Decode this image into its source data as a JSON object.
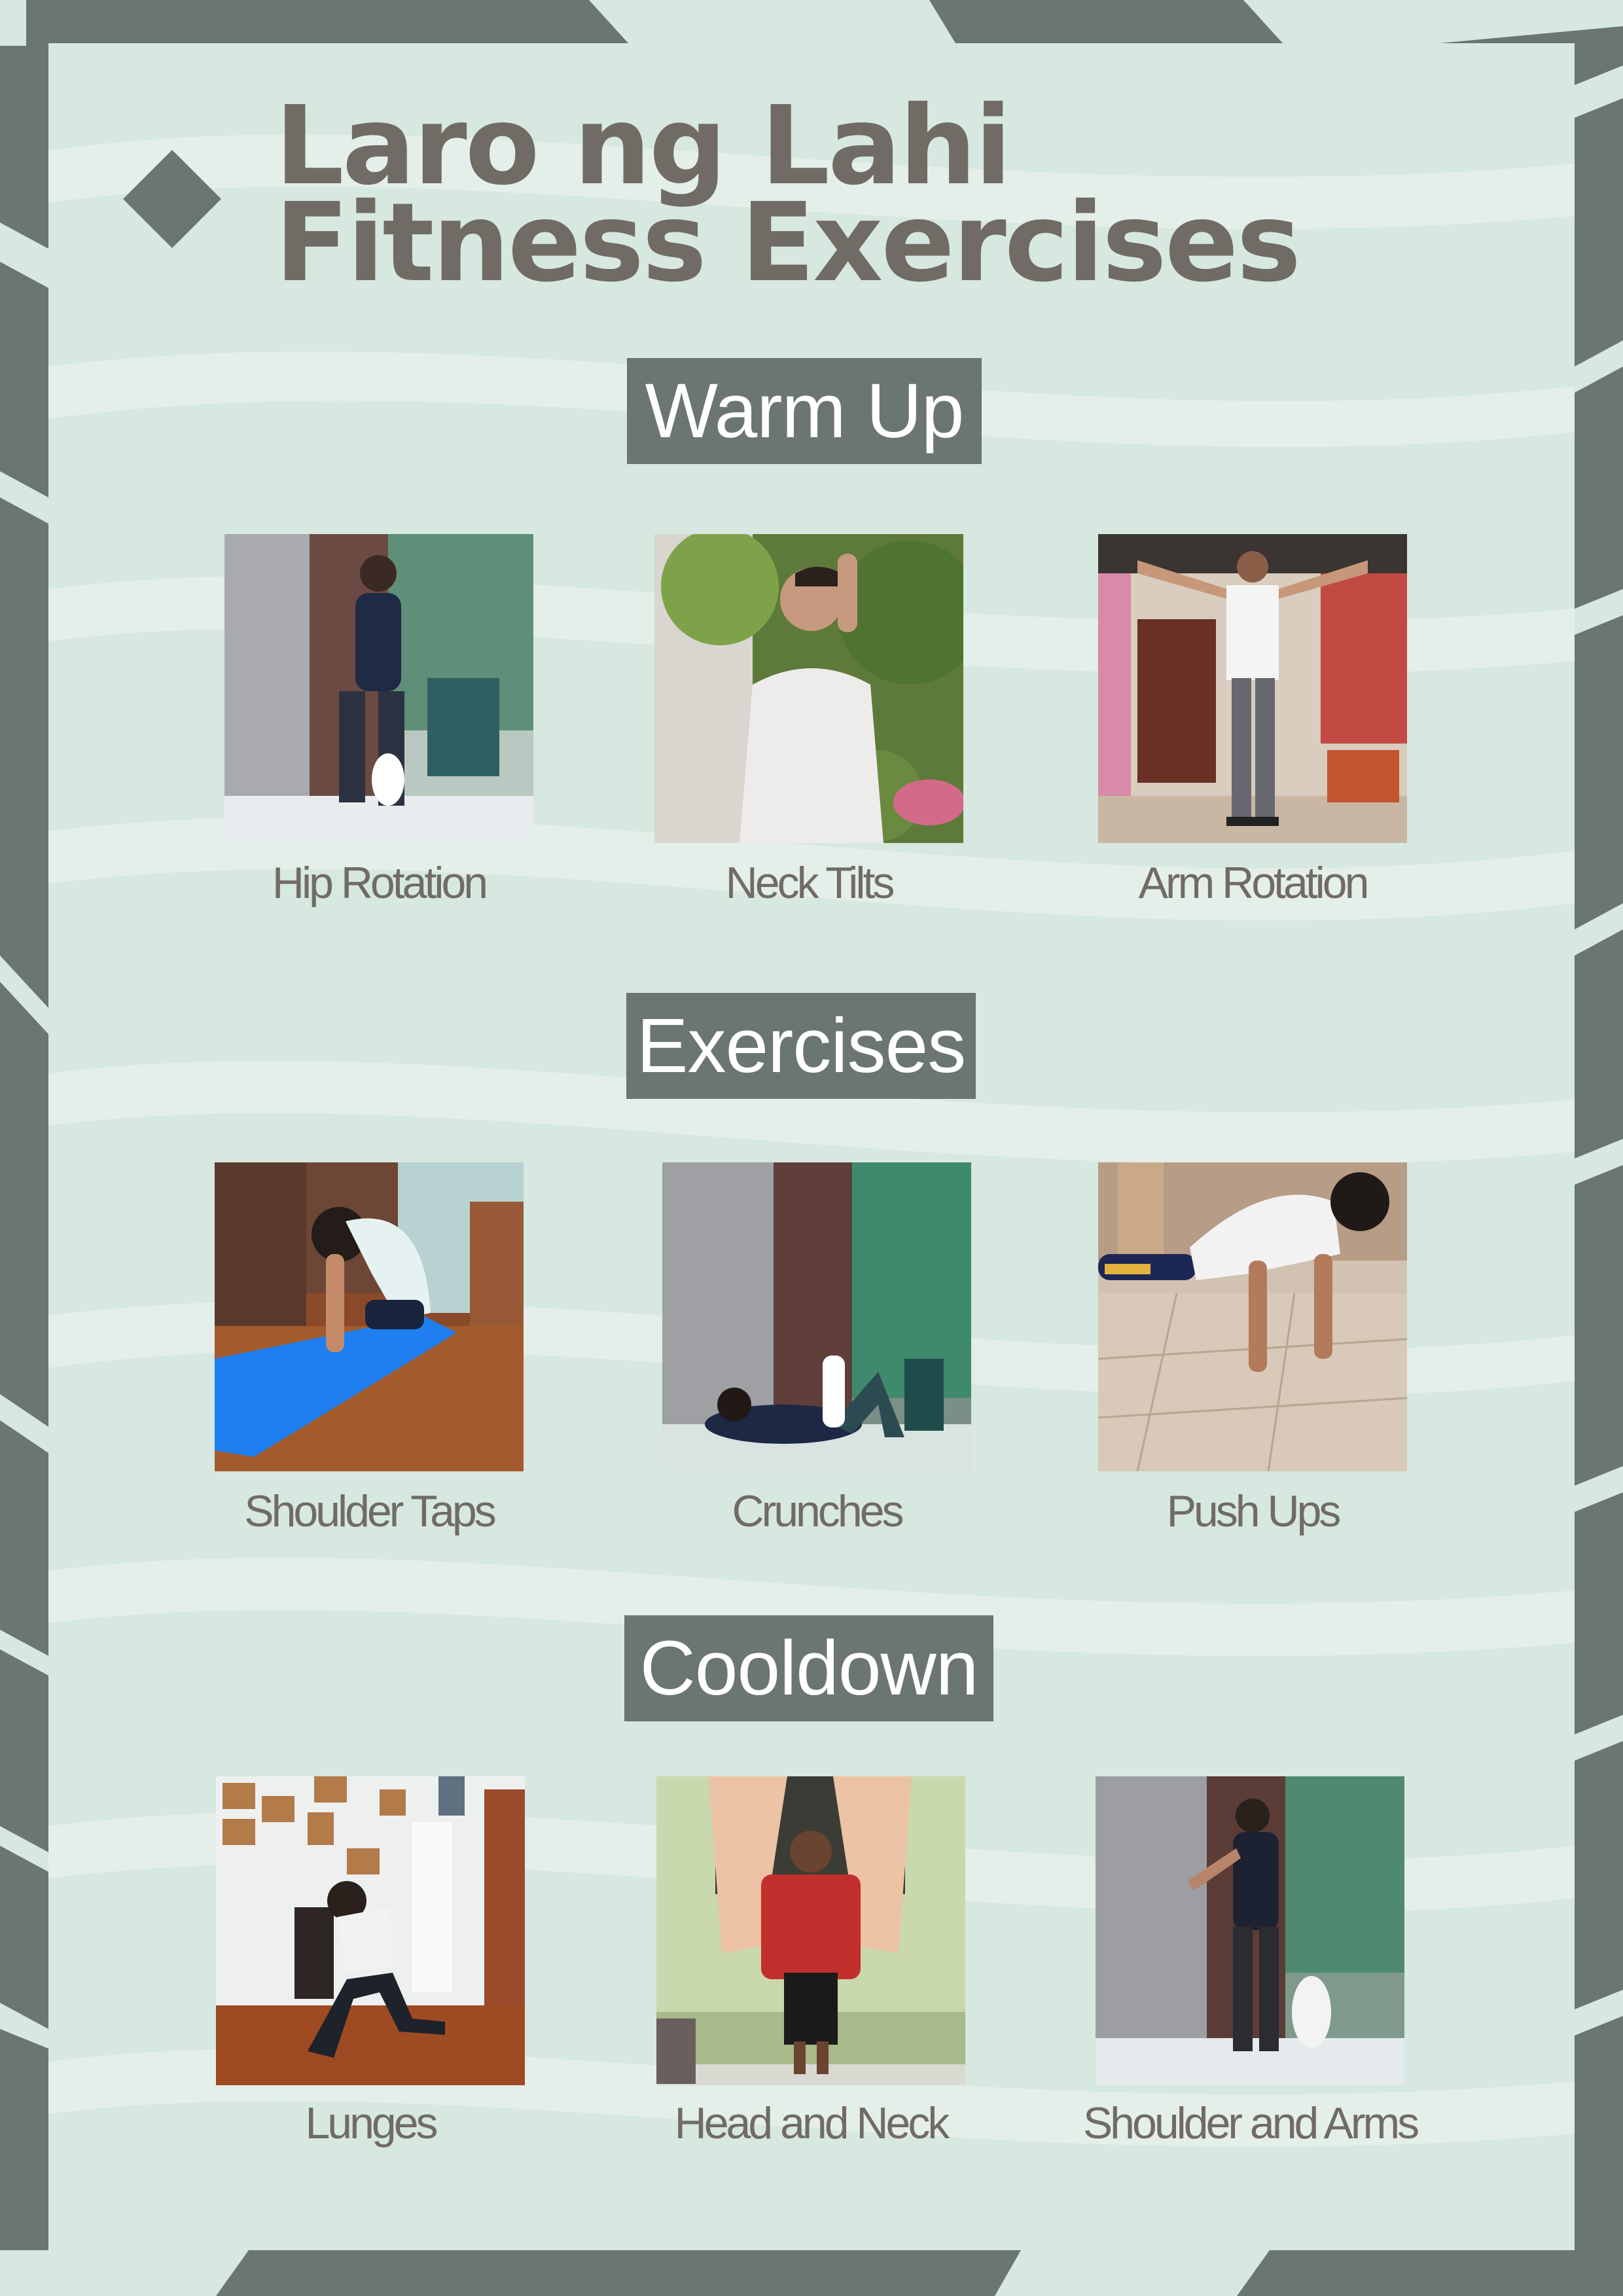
{
  "colors": {
    "frame": "#6b7670",
    "panel": "#d6e8df",
    "wave": "#e4efe9",
    "title": "#716b65",
    "tag_text": "#ffffff"
  },
  "title": {
    "line1": "Laro ng Lahi",
    "line2": "Fitness Exercises",
    "bullet_icon": "diamond-icon"
  },
  "sections": [
    {
      "heading": "Warm Up",
      "items": [
        {
          "label": "Hip Rotation"
        },
        {
          "label": "Neck Tilts"
        },
        {
          "label": "Arm Rotation"
        }
      ]
    },
    {
      "heading": "Exercises",
      "items": [
        {
          "label": "Shoulder Taps"
        },
        {
          "label": "Crunches"
        },
        {
          "label": "Push Ups"
        }
      ]
    },
    {
      "heading": "Cooldown",
      "items": [
        {
          "label": "Lunges"
        },
        {
          "label": "Head and Neck"
        },
        {
          "label": "Shoulder and Arms"
        }
      ]
    }
  ]
}
